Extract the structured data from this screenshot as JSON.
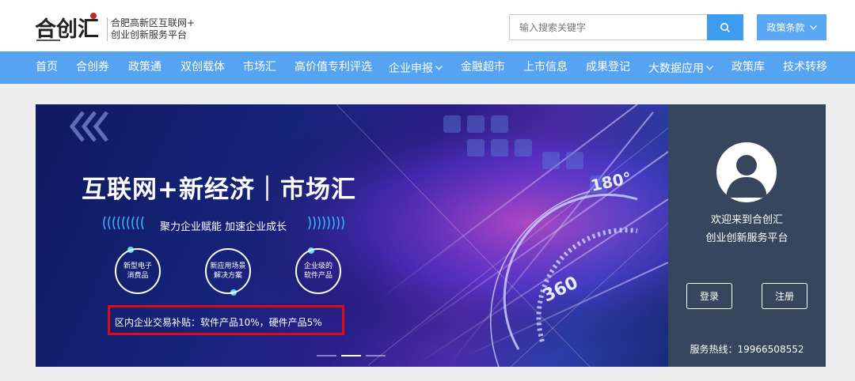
{
  "header": {
    "logo_text": "合创汇",
    "subtitle_line1": "合肥高新区互联网+",
    "subtitle_line2": "创业创新服务平台",
    "search_placeholder": "输入搜索关键字",
    "policy_label": "政策条款"
  },
  "nav": {
    "items": [
      {
        "label": "首页"
      },
      {
        "label": "合创券"
      },
      {
        "label": "政策通"
      },
      {
        "label": "双创载体"
      },
      {
        "label": "市场汇"
      },
      {
        "label": "高价值专利评选"
      },
      {
        "label": "企业申报"
      },
      {
        "label": "金融超市"
      },
      {
        "label": "上市信息"
      },
      {
        "label": "成果登记"
      },
      {
        "label": "大数据应用"
      },
      {
        "label": "政策库"
      },
      {
        "label": "技术转移"
      }
    ]
  },
  "banner": {
    "title": "互联网+新经济｜市场汇",
    "subtitle": "聚力企业赋能 加速企业成长",
    "circles": [
      {
        "line1": "新型电子",
        "line2": "消费品"
      },
      {
        "line1": "新应用场景",
        "line2": "解决方案"
      },
      {
        "line1": "企业级的",
        "line2": "软件产品"
      }
    ],
    "highlight": "区内企业交易补贴：软件产品10%，硬件产品5%",
    "graphic_labels": [
      "180°",
      "360"
    ]
  },
  "panel": {
    "welcome_line1": "欢迎来到合创汇",
    "welcome_line2": "创业创新服务平台",
    "login_label": "登录",
    "register_label": "注册",
    "hotline": "服务热线：19966508552"
  },
  "colors": {
    "nav_bg": "#56a3f2",
    "search_btn": "#3d9bf0",
    "panel_bg": "#37465c",
    "highlight_border": "#e00b12"
  }
}
